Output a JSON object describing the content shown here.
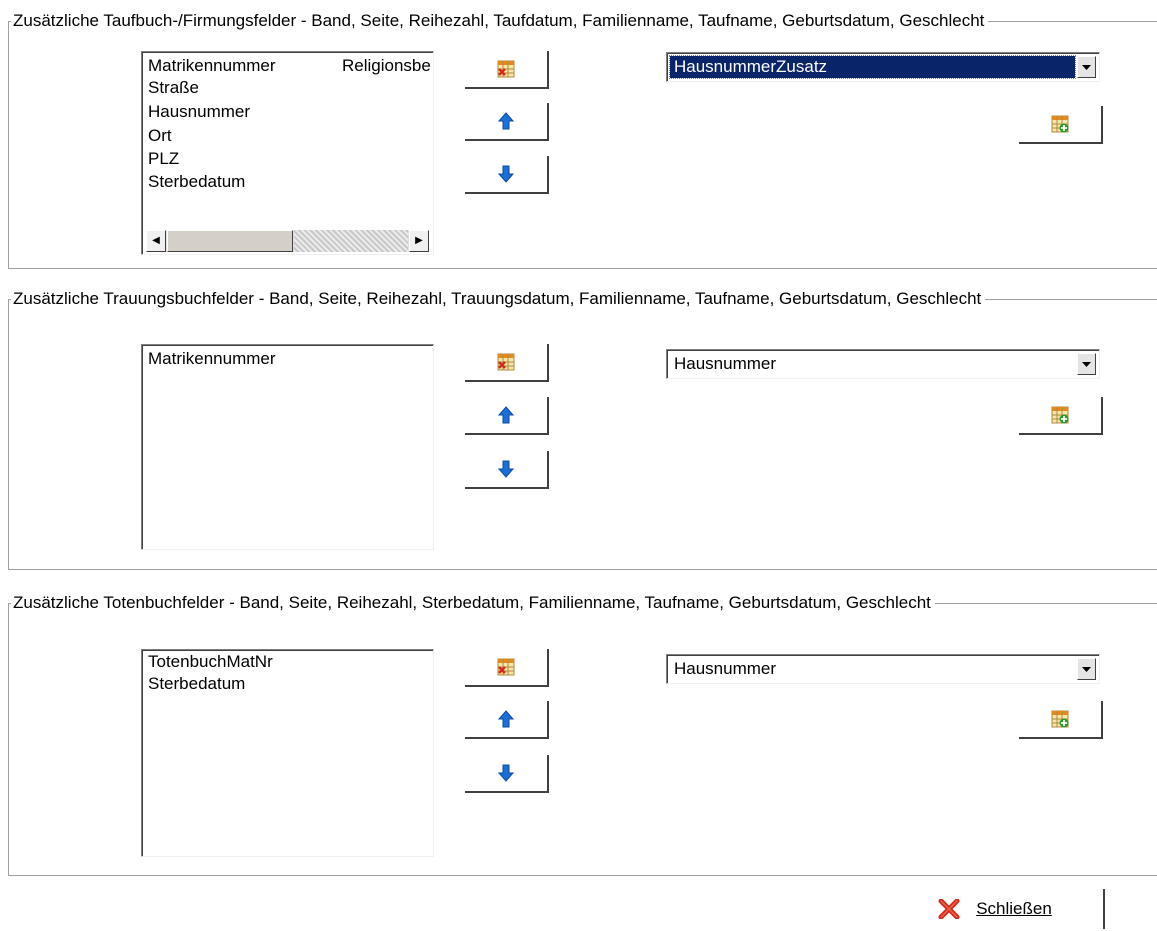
{
  "groups": [
    {
      "title": "Zusätzliche Taufbuch-/Firmungsfelder - Band, Seite, Reihezahl, Taufdatum, Familienname, Taufname, Geburtsdatum, Geschlecht",
      "list_items": [
        "Matrikennummer",
        "Straße",
        "Hausnummer",
        "Ort",
        "PLZ",
        "Sterbedatum"
      ],
      "list_items_col2": [
        "Religionsbe"
      ],
      "combo_value": "HausnummerZusatz"
    },
    {
      "title": "Zusätzliche Trauungsbuchfelder - Band, Seite, Reihezahl, Trauungsdatum, Familienname, Taufname, Geburtsdatum, Geschlecht",
      "list_items": [
        "Matrikennummer"
      ],
      "combo_value": "Hausnummer"
    },
    {
      "title": "Zusätzliche Totenbuchfelder - Band, Seite, Reihezahl, Sterbedatum, Familienname, Taufname, Geburtsdatum, Geschlecht",
      "list_items": [
        "TotenbuchMatNr",
        "Sterbedatum"
      ],
      "combo_value": "Hausnummer"
    }
  ],
  "icons": {
    "remove": "table-delete-icon",
    "up": "arrow-up-icon",
    "down": "arrow-down-icon",
    "add": "table-add-icon",
    "dropdown": "chevron-down-icon",
    "close": "red-x-icon"
  },
  "close_button": {
    "label": "Schließen",
    "accesskey": "S"
  },
  "colors": {
    "selection": "#0a246a",
    "up_down_arrows": "#1a6fd8",
    "close_x": "#d42a1a",
    "add_plus": "#2a9a2a"
  }
}
